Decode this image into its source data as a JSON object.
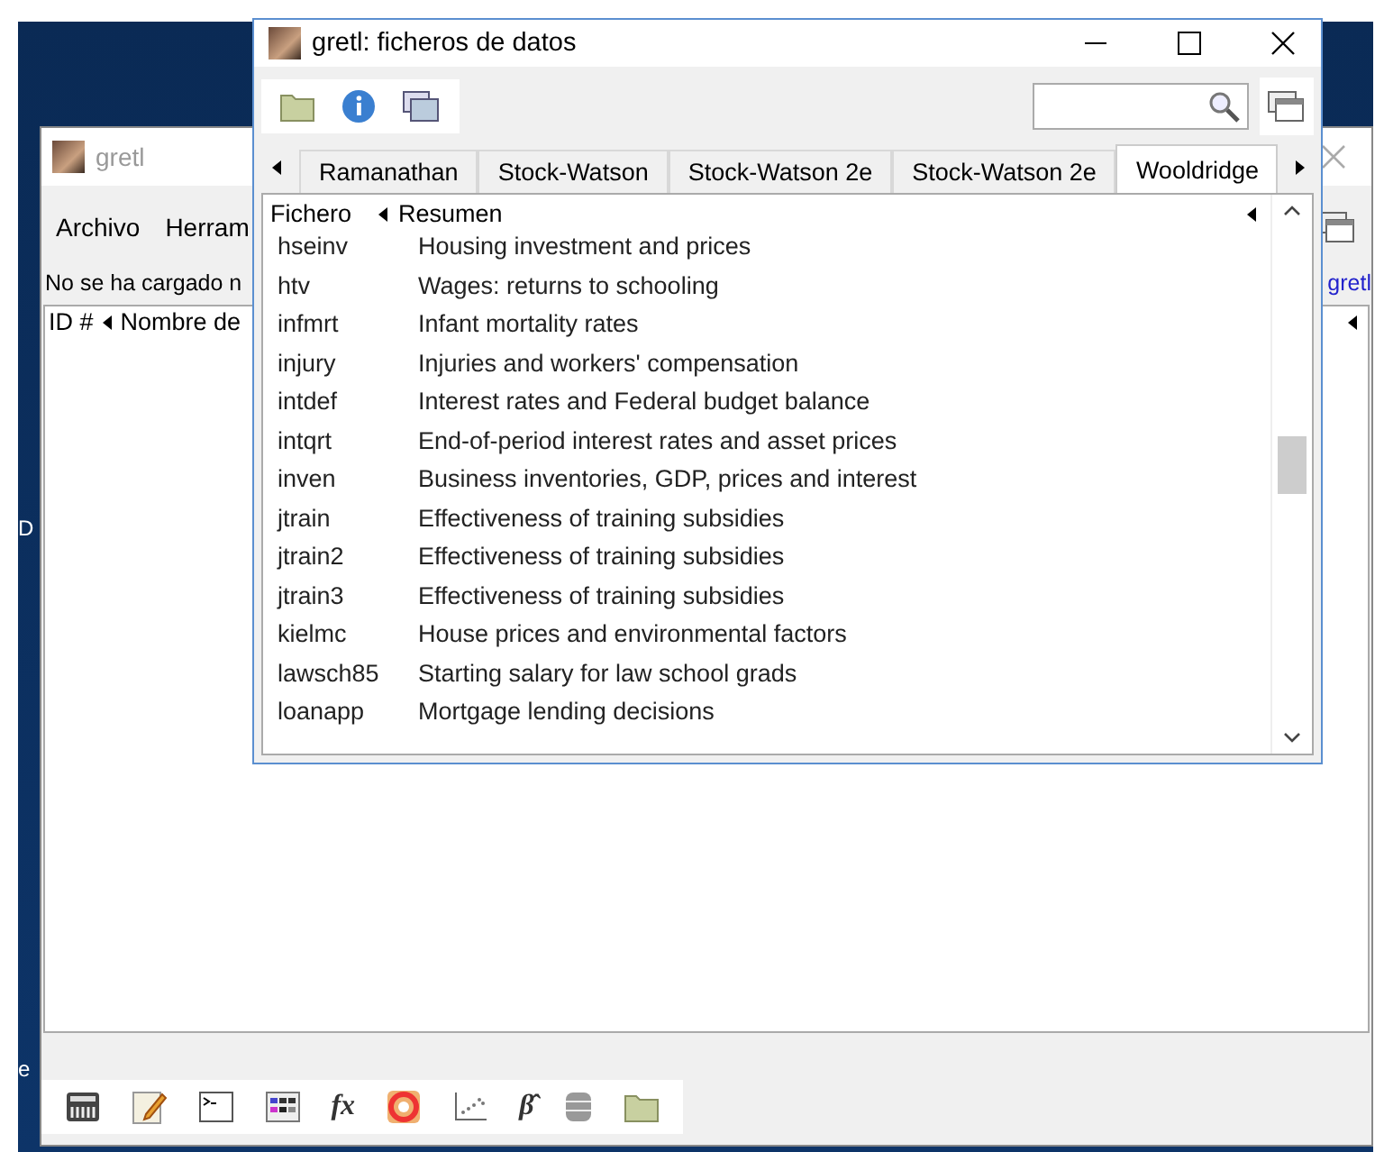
{
  "desktop_labels": [
    "D",
    "e"
  ],
  "main_window": {
    "title": "gretl",
    "menu": [
      "Archivo",
      "Herram"
    ],
    "status": "No se ha cargado n",
    "link": "gretl",
    "columns": [
      "ID #",
      "Nombre de"
    ],
    "toolbar": [
      {
        "kind": "calculator"
      },
      {
        "kind": "notepad"
      },
      {
        "kind": "terminal"
      },
      {
        "kind": "grid"
      },
      {
        "kind": "text",
        "label": "fx"
      },
      {
        "kind": "lifebuoy"
      },
      {
        "kind": "scatter"
      },
      {
        "kind": "text",
        "label": "β̂"
      },
      {
        "kind": "database"
      },
      {
        "kind": "folder"
      }
    ]
  },
  "dialog": {
    "title": "gretl: ficheros de datos",
    "tabs": [
      {
        "label": "Ramanathan",
        "selected": false
      },
      {
        "label": "Stock-Watson",
        "selected": false
      },
      {
        "label": "Stock-Watson 2e",
        "selected": false
      },
      {
        "label": "Stock-Watson 2e",
        "selected": false
      },
      {
        "label": "Wooldridge",
        "selected": true
      }
    ],
    "columns": [
      "Fichero",
      "Resumen"
    ],
    "rows": [
      {
        "file": "hseinv",
        "summary": "Housing investment and prices"
      },
      {
        "file": "htv",
        "summary": "Wages: returns to schooling"
      },
      {
        "file": "infmrt",
        "summary": "Infant mortality rates"
      },
      {
        "file": "injury",
        "summary": "Injuries and workers' compensation"
      },
      {
        "file": "intdef",
        "summary": "Interest rates and Federal budget balance"
      },
      {
        "file": "intqrt",
        "summary": "End-of-period interest rates and asset prices"
      },
      {
        "file": "inven",
        "summary": "Business inventories, GDP, prices and interest"
      },
      {
        "file": "jtrain",
        "summary": "Effectiveness of training subsidies"
      },
      {
        "file": "jtrain2",
        "summary": "Effectiveness of training subsidies"
      },
      {
        "file": "jtrain3",
        "summary": "Effectiveness of training subsidies"
      },
      {
        "file": "kielmc",
        "summary": "House prices and environmental factors"
      },
      {
        "file": "lawsch85",
        "summary": "Starting salary for law school grads"
      },
      {
        "file": "loanapp",
        "summary": "Mortgage lending decisions"
      }
    ]
  }
}
